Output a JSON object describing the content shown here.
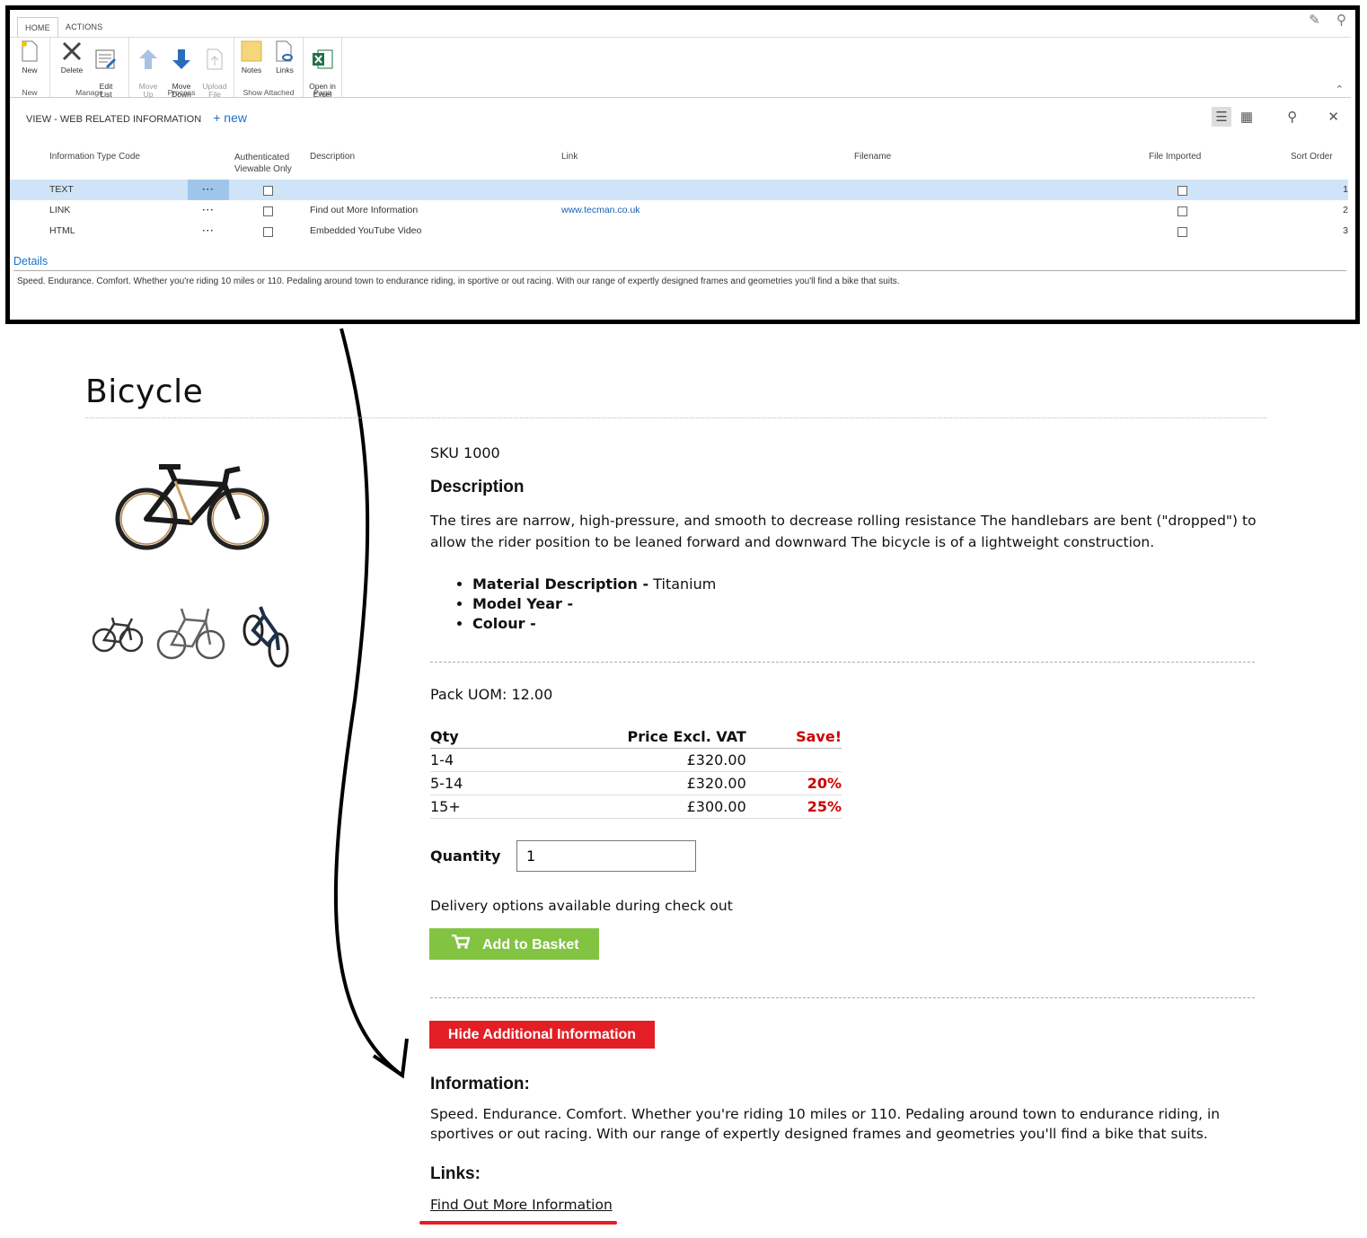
{
  "nav": {
    "tabs": [
      "HOME",
      "ACTIONS"
    ],
    "ribbon": {
      "groups": [
        {
          "label": "New",
          "buttons": [
            {
              "label": "New",
              "icon": "new-doc-icon"
            }
          ]
        },
        {
          "label": "Manage",
          "buttons": [
            {
              "label": "Delete",
              "icon": "delete-x-icon"
            },
            {
              "label": "Edit\nList",
              "icon": "edit-list-icon"
            }
          ]
        },
        {
          "label": "Process",
          "buttons": [
            {
              "label": "Move\nUp",
              "icon": "arrow-up-icon"
            },
            {
              "label": "Move\nDown",
              "icon": "arrow-down-icon"
            },
            {
              "label": "Upload\nFile",
              "icon": "upload-file-icon"
            }
          ]
        },
        {
          "label": "Show Attached",
          "buttons": [
            {
              "label": "Notes",
              "icon": "notes-icon"
            },
            {
              "label": "Links",
              "icon": "links-icon"
            }
          ]
        },
        {
          "label": "Page",
          "buttons": [
            {
              "label": "Open in\nExcel",
              "icon": "excel-icon"
            }
          ]
        }
      ]
    },
    "view_title": "VIEW - WEB RELATED INFORMATION",
    "new_label": "new",
    "columns": {
      "code": "Information Type Code",
      "auth": "Authenticated\nViewable Only",
      "description": "Description",
      "link": "Link",
      "filename": "Filename",
      "imported": "File Imported",
      "sort": "Sort Order"
    },
    "rows": [
      {
        "code": "TEXT",
        "description": "",
        "link": "",
        "sort": "1",
        "selected": true
      },
      {
        "code": "LINK",
        "description": "Find out More Information",
        "link": "www.tecman.co.uk",
        "sort": "2",
        "selected": false
      },
      {
        "code": "HTML",
        "description": "Embedded YouTube Video",
        "link": "",
        "sort": "3",
        "selected": false
      }
    ],
    "details_label": "Details",
    "details_text": "Speed. Endurance. Comfort. Whether you're riding 10 miles or 110. Pedaling around town to endurance riding, in sportive or out racing. With our range of expertly designed frames and geometries you'll find a bike that suits."
  },
  "product": {
    "title": "Bicycle",
    "sku": "SKU 1000",
    "description_heading": "Description",
    "description": "The tires are narrow, high-pressure, and smooth to decrease rolling resistance The handlebars are bent (\"dropped\") to allow the rider position to be leaned forward and downward The bicycle is of a lightweight construction.",
    "attributes": [
      {
        "name": "Material Description -",
        "value": " Titanium"
      },
      {
        "name": "Model Year -",
        "value": ""
      },
      {
        "name": "Colour -",
        "value": ""
      }
    ],
    "pack_uom": "Pack UOM: 12.00",
    "price_table": {
      "headers": {
        "qty": "Qty",
        "price": "Price Excl. VAT",
        "save": "Save!"
      },
      "rows": [
        {
          "qty": "1-4",
          "price": "£320.00",
          "save": ""
        },
        {
          "qty": "5-14",
          "price": "£320.00",
          "save": "20%"
        },
        {
          "qty": "15+",
          "price": "£300.00",
          "save": "25%"
        }
      ]
    },
    "quantity_label": "Quantity",
    "quantity_value": "1",
    "delivery_text": "Delivery options available during check out",
    "basket_label": "Add to Basket",
    "hide_info_label": "Hide Additional Information",
    "information_heading": "Information:",
    "information_text": "Speed. Endurance. Comfort. Whether you're riding 10 miles or 110. Pedaling around town to endurance riding, in sportives or out racing. With our range of expertly designed frames and geometries you'll find a bike that suits.",
    "links_heading": "Links:",
    "link_label": "Find Out More Information"
  },
  "colors": {
    "accent_blue": "#1a73c8",
    "selected_row": "#cfe4f6",
    "basket_green": "#82c341",
    "hide_red": "#e31e24",
    "save_red": "#cc0000"
  }
}
